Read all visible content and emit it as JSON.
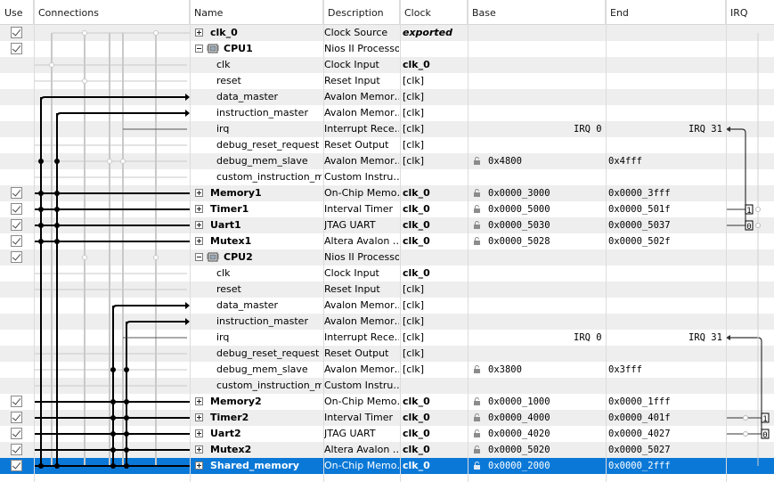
{
  "headers": {
    "use": "Use",
    "connections": "Connections",
    "name": "Name",
    "description": "Description",
    "clock": "Clock",
    "base": "Base",
    "end": "End",
    "irq": "IRQ"
  },
  "rows": [
    {
      "kind": "comp",
      "use": true,
      "expander": "plus",
      "name": "clk_0",
      "desc": "Clock Source",
      "clock": "exported",
      "clock_style": "ital",
      "base": "",
      "end": "",
      "irq_l": "",
      "irq_r": "",
      "lock": false
    },
    {
      "kind": "cpu",
      "use": true,
      "expander": "minus",
      "name": "CPU1",
      "desc": "Nios II Processor",
      "clock": "",
      "base": "",
      "end": "",
      "irq_l": "",
      "irq_r": "",
      "lock": false
    },
    {
      "kind": "port",
      "name": "clk",
      "desc": "Clock Input",
      "clock": "clk_0",
      "clock_style": "bold",
      "base": "",
      "end": "",
      "irq_l": "",
      "irq_r": "",
      "lock": false
    },
    {
      "kind": "port",
      "name": "reset",
      "desc": "Reset Input",
      "clock": "[clk]",
      "base": "",
      "end": "",
      "irq_l": "",
      "irq_r": "",
      "lock": false
    },
    {
      "kind": "port",
      "name": "data_master",
      "desc": "Avalon Memor…",
      "clock": "[clk]",
      "base": "",
      "end": "",
      "irq_l": "",
      "irq_r": "",
      "lock": false
    },
    {
      "kind": "port",
      "name": "instruction_master",
      "desc": "Avalon Memor…",
      "clock": "[clk]",
      "base": "",
      "end": "",
      "irq_l": "",
      "irq_r": "",
      "lock": false
    },
    {
      "kind": "port",
      "name": "irq",
      "desc": "Interrupt Rece…",
      "clock": "[clk]",
      "base": "",
      "end": "",
      "irq_l": "IRQ 0",
      "irq_r": "IRQ 31",
      "lock": false
    },
    {
      "kind": "port",
      "name": "debug_reset_request",
      "desc": "Reset Output",
      "clock": "[clk]",
      "base": "",
      "end": "",
      "irq_l": "",
      "irq_r": "",
      "lock": false
    },
    {
      "kind": "port",
      "name": "debug_mem_slave",
      "desc": "Avalon Memor…",
      "clock": "[clk]",
      "base": "0x4800",
      "end": "0x4fff",
      "irq_l": "",
      "irq_r": "",
      "lock": true
    },
    {
      "kind": "port",
      "name": "custom_instruction_m…",
      "desc": "Custom Instru…",
      "clock": "",
      "base": "",
      "end": "",
      "irq_l": "",
      "irq_r": "",
      "lock": false
    },
    {
      "kind": "comp",
      "use": true,
      "expander": "plus",
      "name": "Memory1",
      "desc": "On-Chip Memo…",
      "clock": "clk_0",
      "clock_style": "bold",
      "base": "0x0000_3000",
      "end": "0x0000_3fff",
      "irq_l": "",
      "irq_r": "",
      "lock": true
    },
    {
      "kind": "comp",
      "use": true,
      "expander": "plus",
      "name": "Timer1",
      "desc": "Interval Timer",
      "clock": "clk_0",
      "clock_style": "bold",
      "base": "0x0000_5000",
      "end": "0x0000_501f",
      "irq_l": "",
      "irq_r": "",
      "lock": true
    },
    {
      "kind": "comp",
      "use": true,
      "expander": "plus",
      "name": "Uart1",
      "desc": "JTAG UART",
      "clock": "clk_0",
      "clock_style": "bold",
      "base": "0x0000_5030",
      "end": "0x0000_5037",
      "irq_l": "",
      "irq_r": "",
      "lock": true
    },
    {
      "kind": "comp",
      "use": true,
      "expander": "plus",
      "name": "Mutex1",
      "desc": "Altera Avalon …",
      "clock": "clk_0",
      "clock_style": "bold",
      "base": "0x0000_5028",
      "end": "0x0000_502f",
      "irq_l": "",
      "irq_r": "",
      "lock": true
    },
    {
      "kind": "cpu",
      "use": true,
      "expander": "minus",
      "name": "CPU2",
      "desc": "Nios II Processor",
      "clock": "",
      "base": "",
      "end": "",
      "irq_l": "",
      "irq_r": "",
      "lock": false
    },
    {
      "kind": "port",
      "name": "clk",
      "desc": "Clock Input",
      "clock": "clk_0",
      "clock_style": "bold",
      "base": "",
      "end": "",
      "irq_l": "",
      "irq_r": "",
      "lock": false
    },
    {
      "kind": "port",
      "name": "reset",
      "desc": "Reset Input",
      "clock": "[clk]",
      "base": "",
      "end": "",
      "irq_l": "",
      "irq_r": "",
      "lock": false
    },
    {
      "kind": "port",
      "name": "data_master",
      "desc": "Avalon Memor…",
      "clock": "[clk]",
      "base": "",
      "end": "",
      "irq_l": "",
      "irq_r": "",
      "lock": false
    },
    {
      "kind": "port",
      "name": "instruction_master",
      "desc": "Avalon Memor…",
      "clock": "[clk]",
      "base": "",
      "end": "",
      "irq_l": "",
      "irq_r": "",
      "lock": false
    },
    {
      "kind": "port",
      "name": "irq",
      "desc": "Interrupt Rece…",
      "clock": "[clk]",
      "base": "",
      "end": "",
      "irq_l": "IRQ 0",
      "irq_r": "IRQ 31",
      "lock": false
    },
    {
      "kind": "port",
      "name": "debug_reset_request",
      "desc": "Reset Output",
      "clock": "[clk]",
      "base": "",
      "end": "",
      "irq_l": "",
      "irq_r": "",
      "lock": false
    },
    {
      "kind": "port",
      "name": "debug_mem_slave",
      "desc": "Avalon Memor…",
      "clock": "[clk]",
      "base": "0x3800",
      "end": "0x3fff",
      "irq_l": "",
      "irq_r": "",
      "lock": true
    },
    {
      "kind": "port",
      "name": "custom_instruction_m…",
      "desc": "Custom Instru…",
      "clock": "",
      "base": "",
      "end": "",
      "irq_l": "",
      "irq_r": "",
      "lock": false
    },
    {
      "kind": "comp",
      "use": true,
      "expander": "plus",
      "name": "Memory2",
      "desc": "On-Chip Memo…",
      "clock": "clk_0",
      "clock_style": "bold",
      "base": "0x0000_1000",
      "end": "0x0000_1fff",
      "irq_l": "",
      "irq_r": "",
      "lock": true
    },
    {
      "kind": "comp",
      "use": true,
      "expander": "plus",
      "name": "Timer2",
      "desc": "Interval Timer",
      "clock": "clk_0",
      "clock_style": "bold",
      "base": "0x0000_4000",
      "end": "0x0000_401f",
      "irq_l": "",
      "irq_r": "",
      "lock": true
    },
    {
      "kind": "comp",
      "use": true,
      "expander": "plus",
      "name": "Uart2",
      "desc": "JTAG UART",
      "clock": "clk_0",
      "clock_style": "bold",
      "base": "0x0000_4020",
      "end": "0x0000_4027",
      "irq_l": "",
      "irq_r": "",
      "lock": true
    },
    {
      "kind": "comp",
      "use": true,
      "expander": "plus",
      "name": "Mutex2",
      "desc": "Altera Avalon …",
      "clock": "clk_0",
      "clock_style": "bold",
      "base": "0x0000_5020",
      "end": "0x0000_5027",
      "irq_l": "",
      "irq_r": "",
      "lock": true
    },
    {
      "kind": "comp",
      "use": true,
      "expander": "plus",
      "name": "Shared_memory",
      "desc": "On-Chip Memo…",
      "clock": "clk_0",
      "clock_style": "bold",
      "base": "0x0000_2000",
      "end": "0x0000_2fff",
      "irq_l": "",
      "irq_r": "",
      "lock": true,
      "selected": true
    }
  ],
  "irq_numbers": {
    "timer1": "1",
    "uart1": "0",
    "timer2": "1",
    "uart2": "0"
  },
  "colors": {
    "selection": "#0a78d7",
    "alt_row": "#eeeeee",
    "grid": "#dcdcdc"
  }
}
